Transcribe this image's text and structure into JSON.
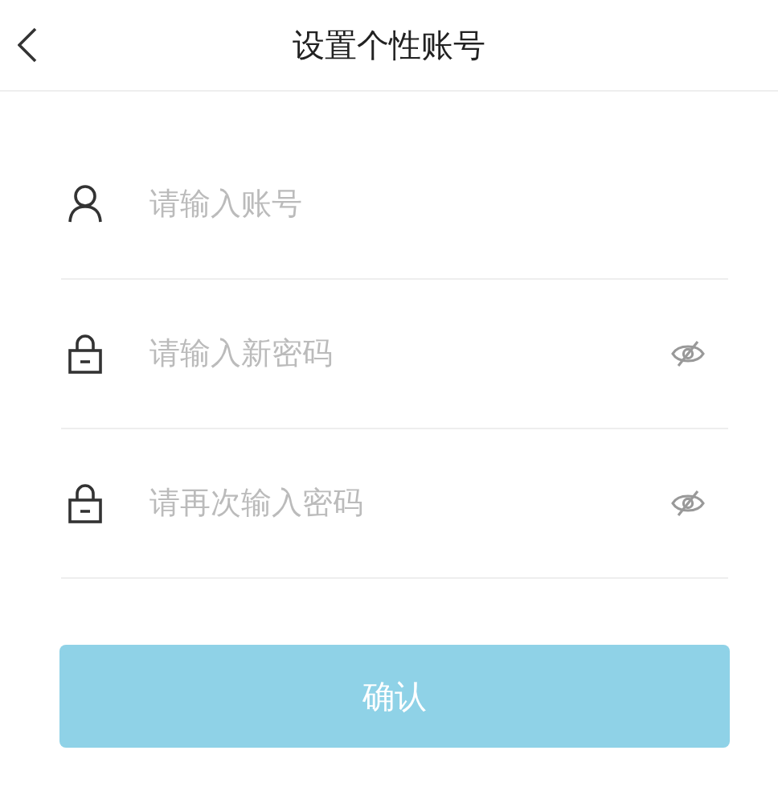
{
  "header": {
    "title": "设置个性账号"
  },
  "fields": [
    {
      "kind": "account",
      "placeholder": "请输入账号"
    },
    {
      "kind": "password",
      "placeholder": "请输入新密码"
    },
    {
      "kind": "password",
      "placeholder": "请再次输入密码"
    }
  ],
  "button": {
    "label": "确认",
    "disabled": true
  }
}
